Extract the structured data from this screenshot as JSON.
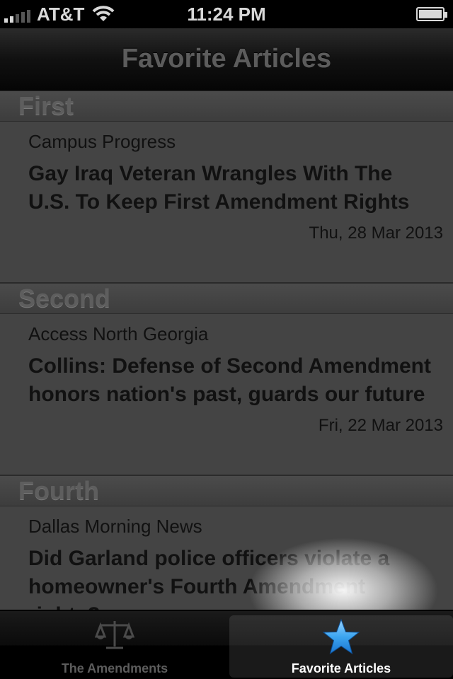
{
  "status_bar": {
    "carrier": "AT&T",
    "time": "11:24 PM"
  },
  "nav": {
    "title": "Favorite Articles"
  },
  "sections": [
    {
      "header": "First",
      "source": "Campus Progress",
      "headline": "Gay Iraq Veteran Wrangles With The U.S. To Keep First Amendment Rights",
      "date": "Thu, 28 Mar 2013"
    },
    {
      "header": "Second",
      "source": "Access North Georgia",
      "headline": "Collins: Defense of Second Amendment honors nation's past, guards our future",
      "date": "Fri, 22 Mar 2013"
    },
    {
      "header": "Fourth",
      "source": "Dallas Morning News",
      "headline": "Did Garland police officers violate a homeowner's Fourth Amendment rights?"
    }
  ],
  "tabs": [
    {
      "label": "The Amendments",
      "icon": "scales-icon",
      "selected": false
    },
    {
      "label": "Favorite Articles",
      "icon": "star-icon",
      "selected": true
    }
  ],
  "colors": {
    "tab_selected": "#ffffff",
    "star": "#3da6f0"
  }
}
